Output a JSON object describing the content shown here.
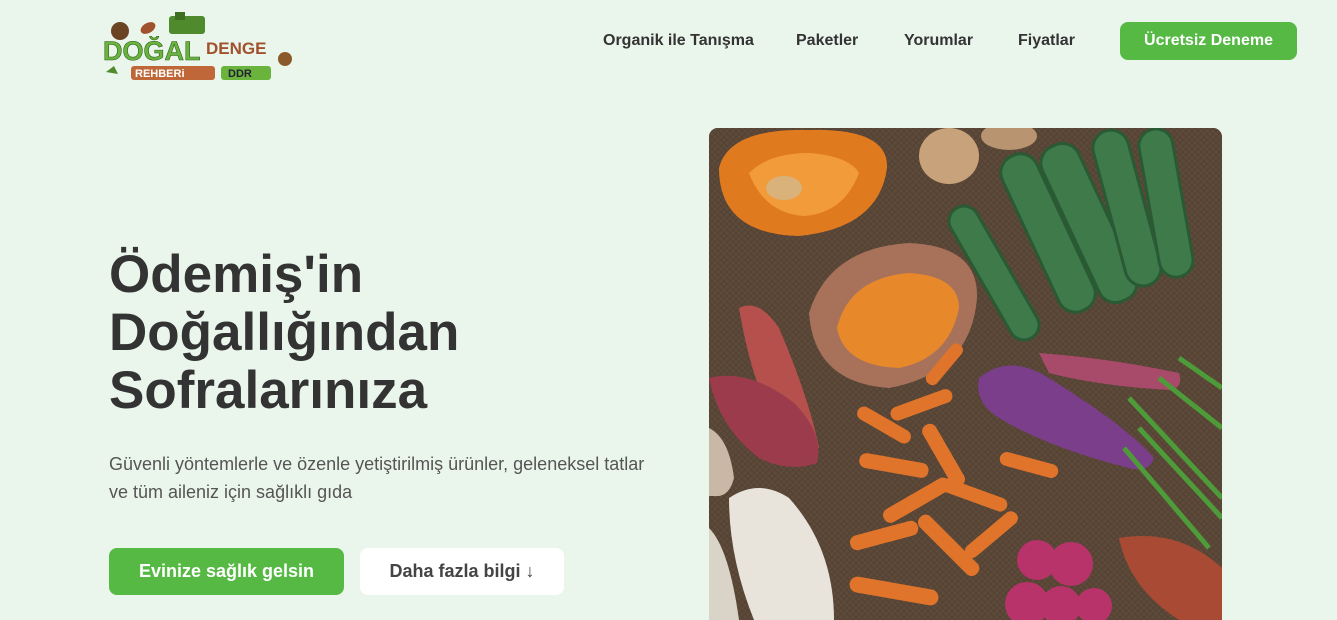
{
  "brand": {
    "logo_line1_a": "DOĞAL",
    "logo_line1_b": "DENGE",
    "logo_line2_a": "REHBERi",
    "logo_line2_b": "DDR",
    "colors": {
      "green": "#6ab43e",
      "brown": "#a0522d",
      "dark": "#3c3c3c"
    }
  },
  "nav": {
    "items": [
      {
        "label": "Organik ile Tanışma"
      },
      {
        "label": "Paketler"
      },
      {
        "label": "Yorumlar"
      },
      {
        "label": "Fiyatlar"
      }
    ],
    "cta_label": "Ücretsiz Deneme"
  },
  "hero": {
    "title_lines": [
      "Ödemiş'in",
      "Doğallığından",
      "Sofralarınıza"
    ],
    "subtitle": "Güvenli yöntemlerle ve özenle yetiştirilmiş ürünler, geleneksel tatlar ve tüm aileniz için sağlıklı gıda",
    "primary_button": "Evinize sağlık gelsin",
    "secondary_button": "Daha fazla bilgi ↓",
    "image_icon": "vegetables-photo"
  },
  "theme": {
    "background": "#eaf6ec",
    "accent": "#55b944",
    "text": "#333333"
  }
}
